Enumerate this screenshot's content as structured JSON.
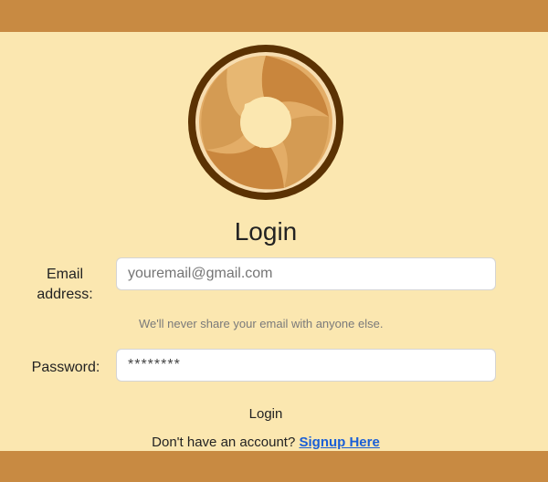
{
  "header": {
    "color": "#c88a42"
  },
  "footer": {
    "color": "#c88a42"
  },
  "logo": {
    "icon": "aperture-logo-icon"
  },
  "form": {
    "title": "Login",
    "email_label": "Email address:",
    "email_placeholder": "youremail@gmail.com",
    "email_value": "",
    "email_help": "We'll never share your email with anyone else.",
    "password_label": "Password:",
    "password_value": "********",
    "login_button": "Login",
    "signup_prompt": "Don't have an account?",
    "signup_link": "Signup Here"
  },
  "colors": {
    "background": "#fbe7b0",
    "accent": "#c88a42",
    "link": "#1a5fd6"
  }
}
